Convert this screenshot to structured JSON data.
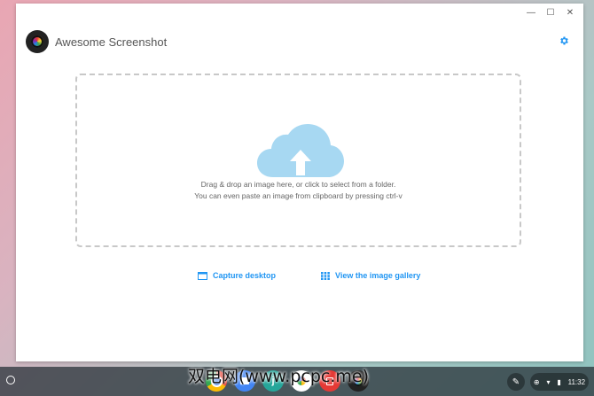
{
  "window_controls": {
    "minimize": "—",
    "maximize": "☐",
    "close": "✕"
  },
  "app": {
    "title": "Awesome Screenshot",
    "settings_icon": "gear-icon"
  },
  "dropzone": {
    "line1": "Drag & drop an image here, or click to select from a folder.",
    "line2": "You can even paste an image from clipboard by pressing ctrl-v",
    "cloud_color": "#a7d8f2"
  },
  "actions": {
    "capture_desktop": "Capture desktop",
    "view_gallery": "View the image gallery"
  },
  "shelf": {
    "apps": [
      {
        "name": "chrome-icon",
        "label": "",
        "color": "#fbbc05"
      },
      {
        "name": "files-icon",
        "label": "",
        "color": "#4285f4"
      },
      {
        "name": "j-app-icon",
        "label": "j",
        "color": "#26a69a"
      },
      {
        "name": "photos-icon",
        "label": "",
        "color": "#ffffff"
      },
      {
        "name": "red-app-icon",
        "label": "",
        "color": "#e53935"
      },
      {
        "name": "awesome-screenshot-icon",
        "label": "",
        "color": "#222222"
      }
    ],
    "tray": {
      "time": "11:32"
    }
  },
  "watermark": "双电网(www.pcpc.me)"
}
